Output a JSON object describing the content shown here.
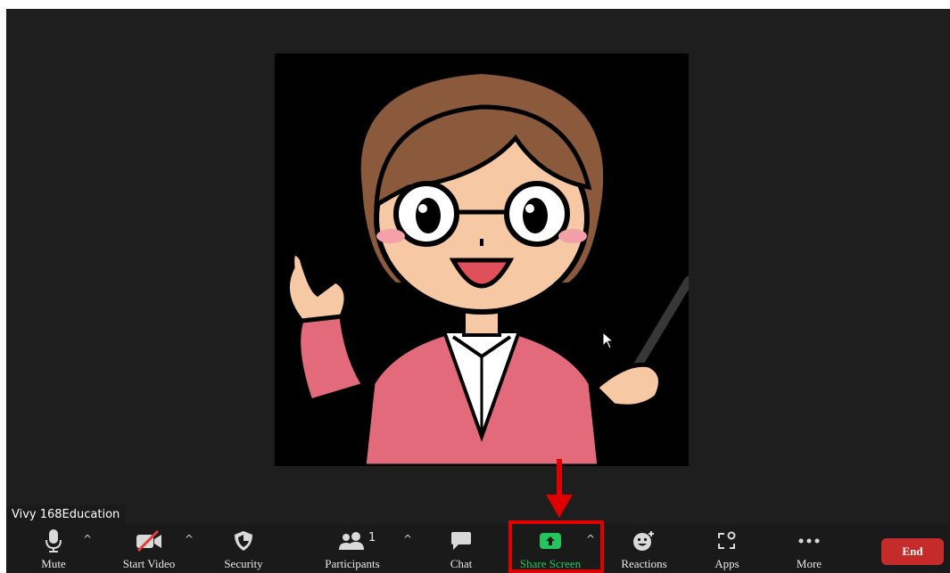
{
  "participant": {
    "name": "Vivy 168Education"
  },
  "toolbar": {
    "mute_label": "Mute",
    "video_label": "Start Video",
    "security_label": "Security",
    "participants_label": "Participants",
    "participants_count": "1",
    "chat_label": "Chat",
    "share_label": "Share Screen",
    "reactions_label": "Reactions",
    "apps_label": "Apps",
    "more_label": "More",
    "end_label": "End"
  },
  "colors": {
    "background": "#1e1e1e",
    "toolbar": "#1a1a1a",
    "share_accent": "#22c55e",
    "end_button": "#c62b2b",
    "annotation_red": "#e10000"
  },
  "icons": [
    "microphone-icon",
    "video-off-icon",
    "shield-icon",
    "participants-icon",
    "chat-icon",
    "share-screen-icon",
    "reactions-icon",
    "apps-icon",
    "more-icon",
    "caret-up-icon"
  ]
}
